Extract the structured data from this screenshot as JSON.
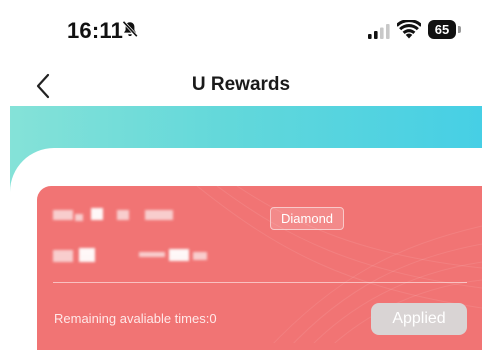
{
  "status_bar": {
    "time": "16:11",
    "battery_level": "65",
    "icons": [
      "bell-muted-icon",
      "signal-icon",
      "wifi-icon",
      "battery-icon"
    ]
  },
  "nav": {
    "back_icon": "chevron-left-icon",
    "title": "U Rewards"
  },
  "hero": {
    "gradient_colors": [
      "#85e2d8",
      "#46cfe5"
    ]
  },
  "member_card": {
    "background_color": "#f17474",
    "tier": "Diamond",
    "remaining_text": "Remaining avaliable times:0",
    "applied_label": "Applied",
    "applied_button_color": "#d9d4d4"
  }
}
